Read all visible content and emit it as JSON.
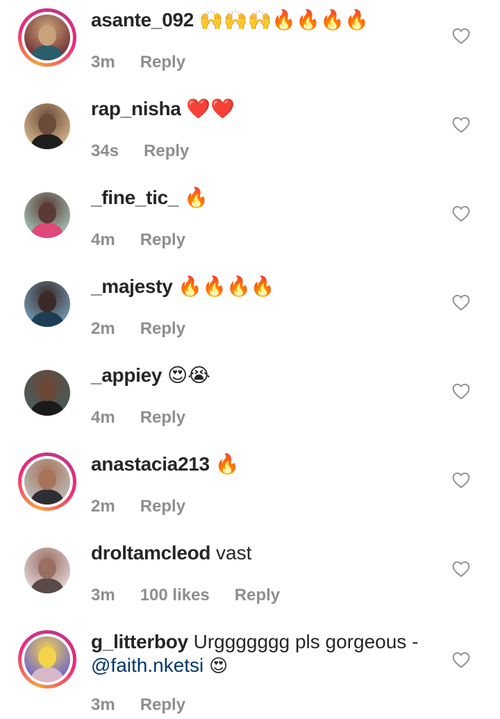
{
  "comments": [
    {
      "username": "asante_092",
      "text": "🙌🙌🙌🔥🔥🔥🔥",
      "time": "3m",
      "likes": "",
      "reply": "Reply",
      "story_ring": true,
      "avatar_colors": [
        "#7a3b3b",
        "#c9a27a",
        "#2b5d6b"
      ]
    },
    {
      "username": "rap_nisha",
      "text": "❤️❤️",
      "time": "34s",
      "likes": "",
      "reply": "Reply",
      "story_ring": false,
      "avatar_colors": [
        "#c8a882",
        "#6b4b3a",
        "#1e1e1e"
      ]
    },
    {
      "username": "_fine_tic_",
      "text": "🔥",
      "time": "4m",
      "likes": "",
      "reply": "Reply",
      "story_ring": false,
      "avatar_colors": [
        "#9ab3a8",
        "#5b3a35",
        "#e0487a"
      ]
    },
    {
      "username": "_majesty",
      "text": "🔥🔥🔥🔥",
      "time": "2m",
      "likes": "",
      "reply": "Reply",
      "story_ring": false,
      "avatar_colors": [
        "#6d8fa6",
        "#3a2a28",
        "#1d3d55"
      ]
    },
    {
      "username": "_appiey",
      "text": "😍😭",
      "time": "4m",
      "likes": "",
      "reply": "Reply",
      "story_ring": false,
      "avatar_colors": [
        "#4a5a5a",
        "#6b4836",
        "#1b1b1b"
      ]
    },
    {
      "username": "anastacia213",
      "text": "🔥",
      "time": "2m",
      "likes": "",
      "reply": "Reply",
      "story_ring": true,
      "avatar_colors": [
        "#b9b3ad",
        "#a7745a",
        "#2e2e36"
      ]
    },
    {
      "username": "droltamcleod",
      "text": "vast",
      "time": "3m",
      "likes": "100 likes",
      "reply": "Reply",
      "story_ring": false,
      "avatar_colors": [
        "#d9c9c9",
        "#9a6e63",
        "#5a4a4a"
      ]
    },
    {
      "username": "g_litterboy",
      "text": "Urggggggg pls gorgeous -",
      "mention": "@faith.nketsi",
      "mention_suffix": "😍",
      "time": "3m",
      "likes": "",
      "reply": "Reply",
      "story_ring": true,
      "avatar_colors": [
        "#7c6fc4",
        "#f3d34a",
        "#d8b8c8"
      ]
    }
  ],
  "colors": {
    "text": "#262626",
    "secondary": "#8e8e8e",
    "mention": "#00376b"
  },
  "icons": {
    "like": "heart-outline-icon"
  }
}
